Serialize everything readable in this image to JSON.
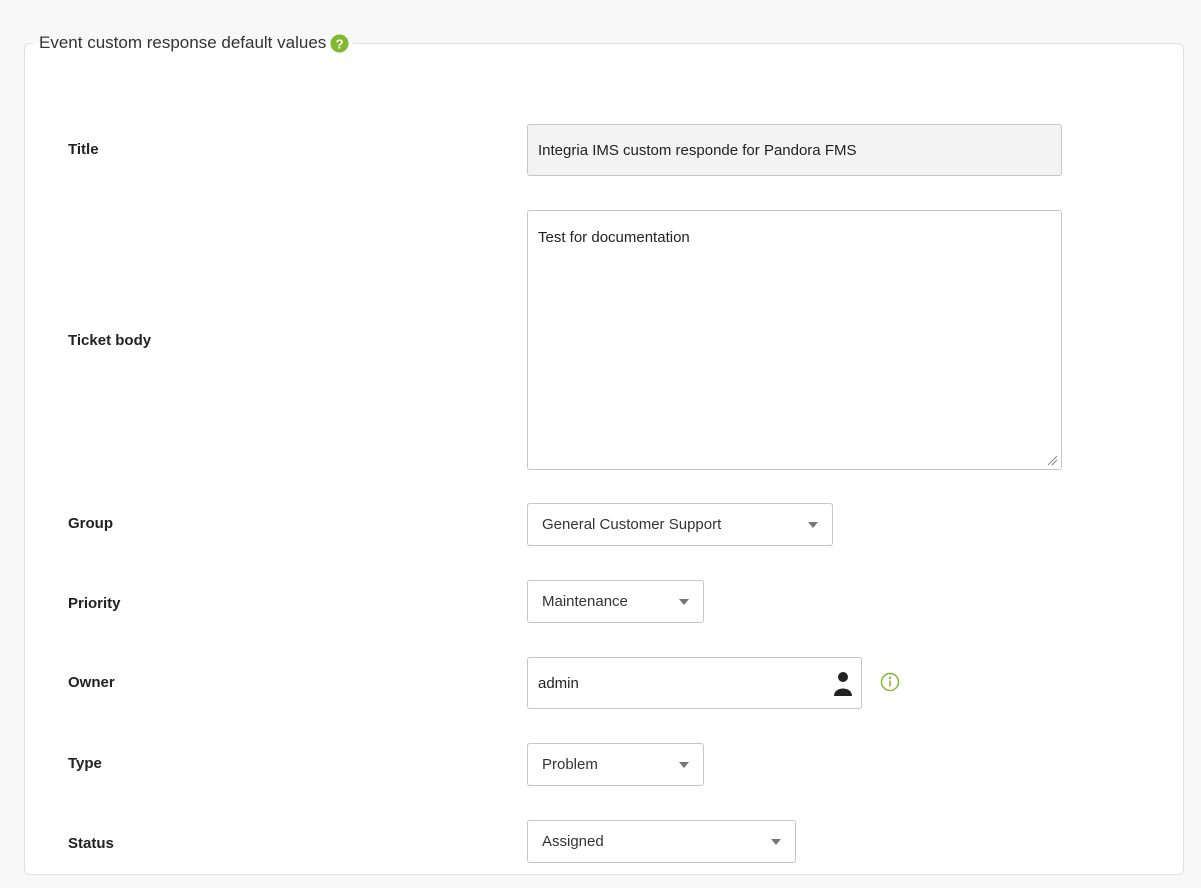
{
  "panel": {
    "legend": "Event custom response default values"
  },
  "fields": {
    "title": {
      "label": "Title",
      "value": "Integria IMS custom responde for Pandora FMS"
    },
    "ticket_body": {
      "label": "Ticket body",
      "value": "Test for documentation"
    },
    "group": {
      "label": "Group",
      "selected": "General Customer Support"
    },
    "priority": {
      "label": "Priority",
      "selected": "Maintenance"
    },
    "owner": {
      "label": "Owner",
      "value": "admin"
    },
    "type": {
      "label": "Type",
      "selected": "Problem"
    },
    "status": {
      "label": "Status",
      "selected": "Assigned"
    }
  },
  "icons": {
    "help": "help-icon",
    "user": "user-icon",
    "info": "info-icon",
    "dropdown": "chevron-down-icon"
  },
  "colors": {
    "accent_green": "#82b92e",
    "input_border": "#c6c6c6",
    "readonly_bg": "#f3f3f3"
  }
}
